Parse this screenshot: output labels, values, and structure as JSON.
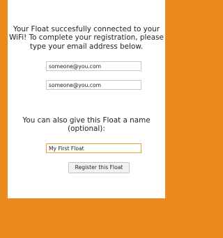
{
  "registration": {
    "intro_text": "Your Float succesfully connected to your WiFi! To complete your registration, please type your email address below.",
    "email_value": "someone@you.com",
    "email_confirm_value": "someone@you.com",
    "name_prompt": "You can also give this Float a name (optional):",
    "float_name_value": "My First Float",
    "submit_label": "Register this Float"
  },
  "colors": {
    "background": "#eb8a1a",
    "card": "#ffffff",
    "focused_field_border": "#e9a23b"
  }
}
